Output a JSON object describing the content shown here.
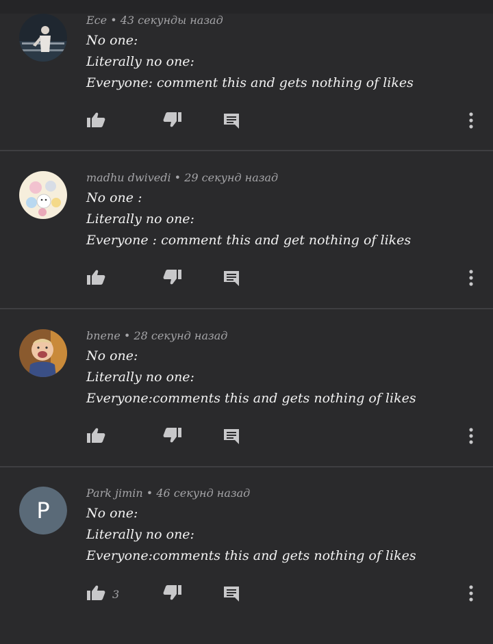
{
  "comments": [
    {
      "author": "Ece",
      "time": "43 секунды назад",
      "lines": [
        "No one:",
        "Literally no one:",
        "Everyone: comment this and gets nothing of likes"
      ],
      "likes": "",
      "avatar": {
        "type": "photo",
        "icon": "dancer-photo"
      }
    },
    {
      "author": "madhu dwivedi",
      "time": "29 секунд назад",
      "lines": [
        "No one :",
        "Literally no one:",
        "Everyone : comment this and get nothing of likes"
      ],
      "likes": "",
      "avatar": {
        "type": "photo",
        "icon": "cartoon-characters-photo"
      }
    },
    {
      "author": "bnene",
      "time": "28 секунд назад",
      "lines": [
        "No one:",
        "Literally no one:",
        "Everyone:comments this and gets nothing of likes"
      ],
      "likes": "",
      "avatar": {
        "type": "photo",
        "icon": "child-photo"
      }
    },
    {
      "author": "Park jimin",
      "time": "46 секунд назад",
      "lines": [
        "No one:",
        "Literally no one:",
        "Everyone:comments this and gets nothing  of likes"
      ],
      "likes": "3",
      "avatar": {
        "type": "letter",
        "letter": "P",
        "color": "#5a6a78"
      }
    }
  ],
  "separator": "•",
  "icons": {
    "like": "thumb-up-icon",
    "dislike": "thumb-down-icon",
    "reply": "comment-icon",
    "menu": "more-vert-icon"
  },
  "colors": {
    "background": "#2a2a2c",
    "text": "#f2f2f2",
    "meta": "#a5a5a8",
    "icon": "#c8c8ca"
  }
}
